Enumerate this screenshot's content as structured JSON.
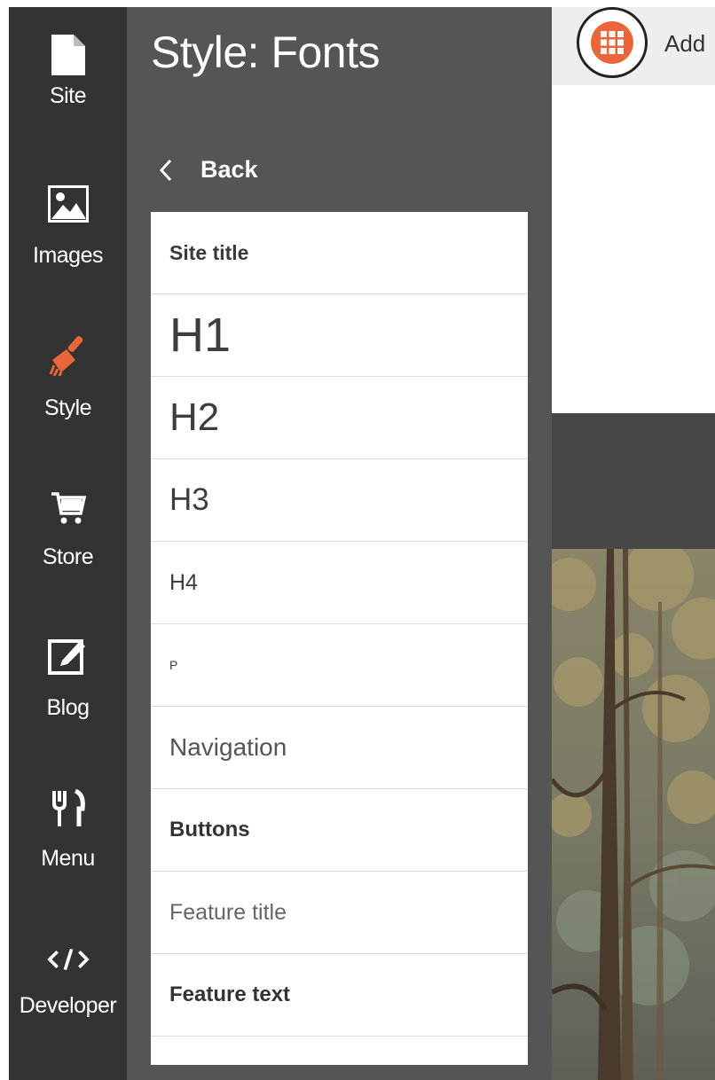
{
  "rail": {
    "items": [
      {
        "label": "Site",
        "icon": "file-icon"
      },
      {
        "label": "Images",
        "icon": "image-icon"
      },
      {
        "label": "Style",
        "icon": "brush-icon",
        "active": true
      },
      {
        "label": "Store",
        "icon": "cart-icon"
      },
      {
        "label": "Blog",
        "icon": "edit-icon"
      },
      {
        "label": "Menu",
        "icon": "fork-knife-icon"
      },
      {
        "label": "Developer",
        "icon": "code-icon"
      }
    ]
  },
  "panel": {
    "title": "Style: Fonts",
    "back_label": "Back",
    "font_items": [
      "Site title",
      "H1",
      "H2",
      "H3",
      "H4",
      "P",
      "Navigation",
      "Buttons",
      "Feature title",
      "Feature text"
    ]
  },
  "topbar": {
    "add_label": "Add"
  },
  "colors": {
    "rail_bg": "#333333",
    "panel_bg": "#555555",
    "accent": "#e8663a"
  }
}
